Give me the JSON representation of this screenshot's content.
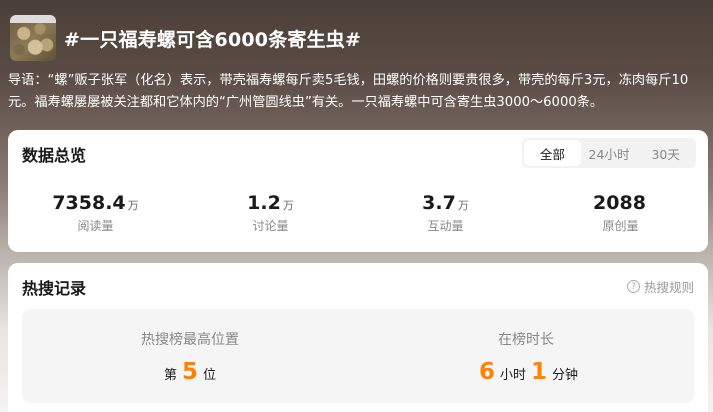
{
  "topic": {
    "title": "#一只福寿螺可含6000条寄生虫#",
    "guide": "导语：“螺”贩子张军（化名）表示，带壳福寿螺每斤卖5毛钱，田螺的价格则要贵很多，带壳的每斤3元，冻肉每斤10元。福寿螺屡屡被关注都和它体内的“广州管圆线虫”有关。一只福寿螺中可含寄生虫3000～6000条。"
  },
  "overview": {
    "title": "数据总览",
    "tabs": [
      "全部",
      "24小时",
      "30天"
    ],
    "active_tab": "全部",
    "stats": [
      {
        "value": "7358.4",
        "unit": "万",
        "label": "阅读量"
      },
      {
        "value": "1.2",
        "unit": "万",
        "label": "讨论量"
      },
      {
        "value": "3.7",
        "unit": "万",
        "label": "互动量"
      },
      {
        "value": "2088",
        "unit": "",
        "label": "原创量"
      }
    ]
  },
  "hot": {
    "title": "热搜记录",
    "rules_label": "热搜规则",
    "rules_icon": "question-circle-icon",
    "peak": {
      "label": "热搜榜最高位置",
      "prefix": "第",
      "value": "5",
      "suffix": "位"
    },
    "duration": {
      "label": "在榜时长",
      "hours": "6",
      "hours_unit": "小时",
      "minutes": "1",
      "minutes_unit": "分钟"
    },
    "accent_color": "#ff8200"
  }
}
